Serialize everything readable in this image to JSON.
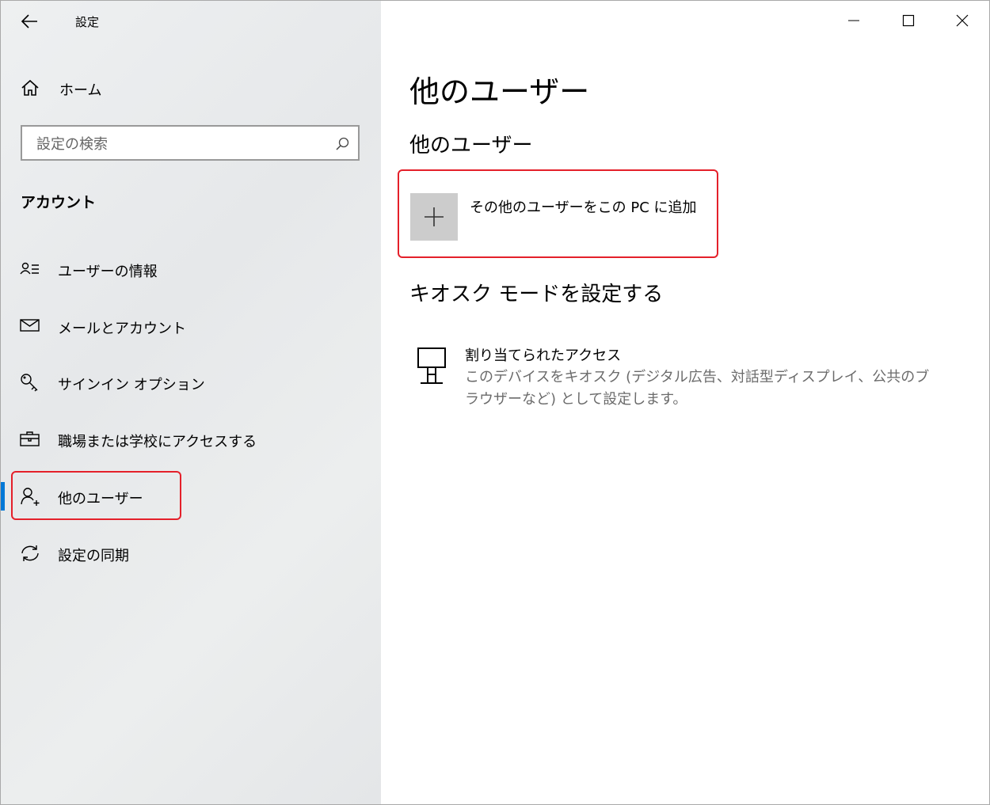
{
  "app_title": "設定",
  "nav": {
    "home": "ホーム",
    "search_placeholder": "設定の検索",
    "section": "アカウント",
    "items": [
      {
        "label": "ユーザーの情報",
        "icon": "user-info-icon"
      },
      {
        "label": "メールとアカウント",
        "icon": "mail-icon"
      },
      {
        "label": "サインイン オプション",
        "icon": "key-icon"
      },
      {
        "label": "職場または学校にアクセスする",
        "icon": "briefcase-icon"
      },
      {
        "label": "他のユーザー",
        "icon": "add-person-icon",
        "selected": true
      },
      {
        "label": "設定の同期",
        "icon": "sync-icon"
      }
    ]
  },
  "main": {
    "page_title": "他のユーザー",
    "other_users_heading": "他のユーザー",
    "add_user_label": "その他のユーザーをこの PC に追加",
    "kiosk_heading": "キオスク モードを設定する",
    "kiosk_item_title": "割り当てられたアクセス",
    "kiosk_item_desc": "このデバイスをキオスク (デジタル広告、対話型ディスプレイ、公共のブラウザーなど) として設定します。"
  },
  "colors": {
    "accent": "#0078d7",
    "highlight": "#e4202a",
    "tile": "#cccccc"
  }
}
